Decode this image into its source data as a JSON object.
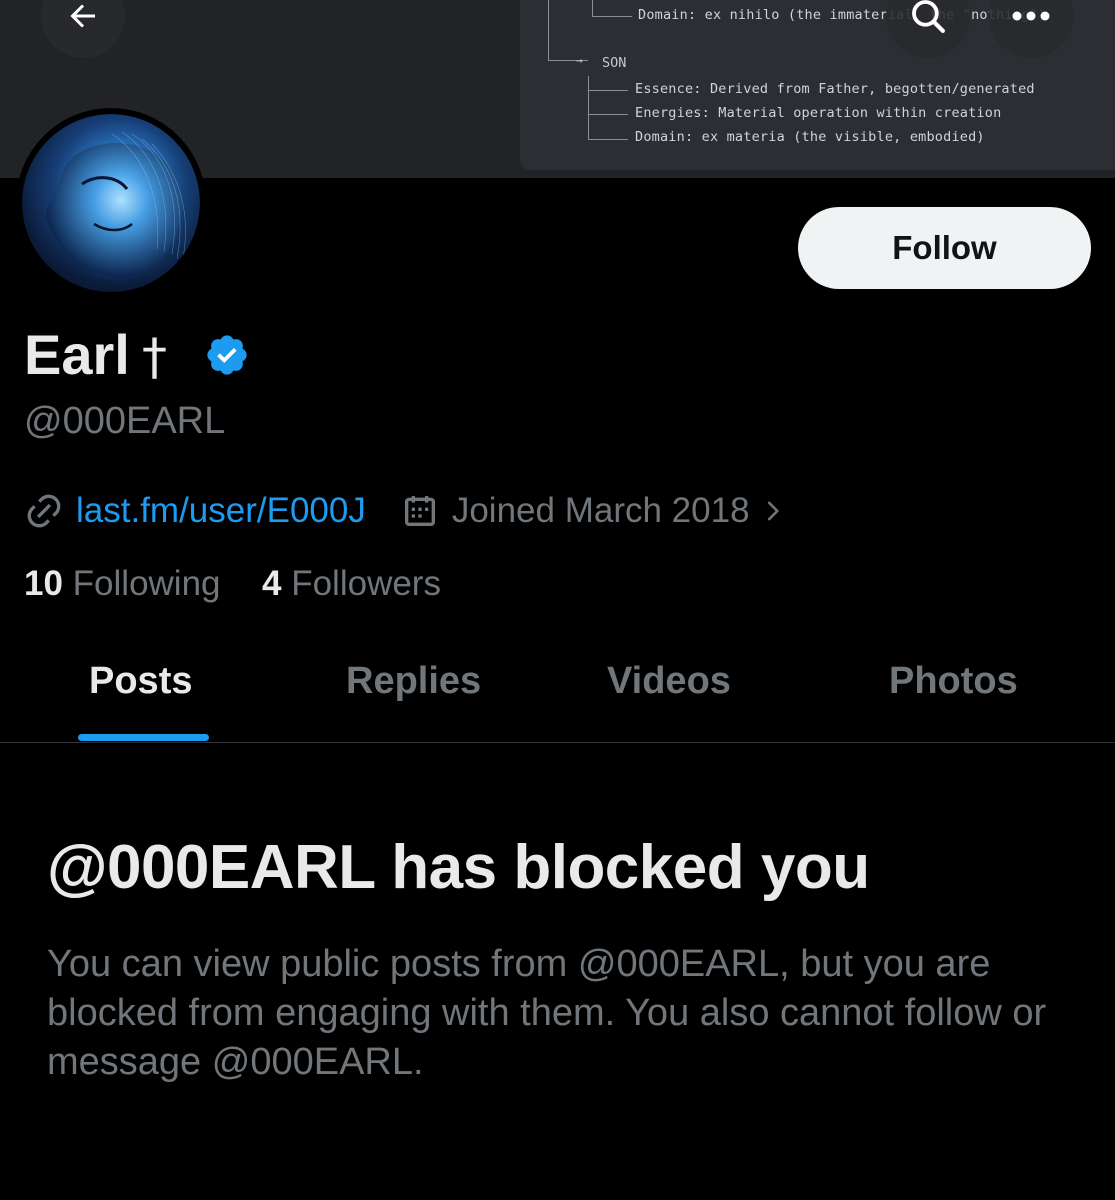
{
  "banner": {
    "tree_line_domain_father": "Domain: ex nihilo (the immaterial, the \"nothing\")",
    "son_label": "SON",
    "son_items": [
      "Essence: Derived from Father, begotten/generated",
      "Energies: Material operation within creation",
      "Domain: ex materia (the visible, embodied)"
    ]
  },
  "header": {
    "back_icon": "arrow-left-icon",
    "search_icon": "search-icon",
    "more_icon": "more-horizontal-icon"
  },
  "profile": {
    "display_name": "Earl",
    "name_symbol": "†",
    "verified_icon": "verified-badge-icon",
    "verified_color": "#1d9bf0",
    "handle": "@000EARL",
    "follow_label": "Follow",
    "link_icon": "link-icon",
    "website": "last.fm/user/E000J",
    "calendar_icon": "calendar-icon",
    "joined": "Joined March 2018",
    "chevron_icon": "chevron-right-icon",
    "following_count": "10",
    "following_label": "Following",
    "followers_count": "4",
    "followers_label": "Followers"
  },
  "tabs": [
    {
      "label": "Posts",
      "active": true
    },
    {
      "label": "Replies",
      "active": false
    },
    {
      "label": "Videos",
      "active": false
    },
    {
      "label": "Photos",
      "active": false
    }
  ],
  "blocked": {
    "title": "@000EARL has blocked you",
    "description": "You can view public posts from @000EARL, but you are blocked from engaging with them. You also cannot follow or message @000EARL."
  },
  "colors": {
    "accent": "#1d9bf0",
    "background": "#000000",
    "text_primary": "#e7e9ea",
    "text_secondary": "#71767b"
  }
}
